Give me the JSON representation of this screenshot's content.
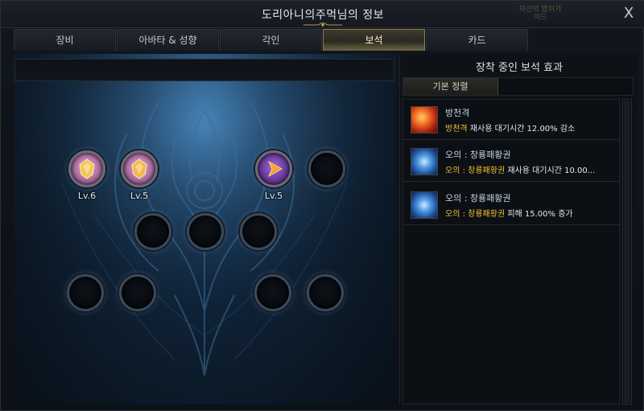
{
  "window": {
    "title": "도리아니의주먹님의 정보",
    "corner_text": "자신의 맵쉬가이드",
    "close_label": "X"
  },
  "tabs": [
    {
      "label": "장비",
      "active": false
    },
    {
      "label": "아바타 & 성향",
      "active": false
    },
    {
      "label": "각인",
      "active": false
    },
    {
      "label": "보석",
      "active": true
    },
    {
      "label": "카드",
      "active": false
    }
  ],
  "gems": {
    "slots": [
      {
        "slot": 1,
        "filled": true,
        "color": "pink",
        "level": "Lv.6"
      },
      {
        "slot": 2,
        "filled": true,
        "color": "pink",
        "level": "Lv.5"
      },
      {
        "slot": 3,
        "filled": true,
        "color": "purple",
        "level": "Lv.5"
      },
      {
        "slot": 4,
        "filled": false,
        "level": ""
      },
      {
        "slot": 5,
        "filled": false,
        "level": ""
      },
      {
        "slot": 6,
        "filled": false,
        "level": ""
      },
      {
        "slot": 7,
        "filled": false,
        "level": ""
      },
      {
        "slot": 8,
        "filled": false,
        "level": ""
      },
      {
        "slot": 9,
        "filled": false,
        "level": ""
      },
      {
        "slot": 10,
        "filled": false,
        "level": ""
      },
      {
        "slot": 11,
        "filled": false,
        "level": ""
      }
    ]
  },
  "effects_panel": {
    "title": "장착 중인 보석 효과",
    "sort_label": "기본 정렬",
    "items": [
      {
        "name": "방천격",
        "icon": "fire-strike-icon",
        "highlight": "방천격",
        "desc": " 재사용 대기시간 12.00% 감소"
      },
      {
        "name": "오의 : 창룡패황권",
        "icon": "dragon-fist-icon",
        "highlight": "오의 : 창룡패황권",
        "desc": " 재사용 대기시간 10.00..."
      },
      {
        "name": "오의 : 창룡패황권",
        "icon": "dragon-fist-icon",
        "highlight": "오의 : 창룡패황권",
        "desc": " 피해 15.00% 증가"
      }
    ]
  },
  "colors": {
    "accent_gold": "#f0c432",
    "active_tab": "#6e6446",
    "panel_glow": "#2a5d8a"
  }
}
